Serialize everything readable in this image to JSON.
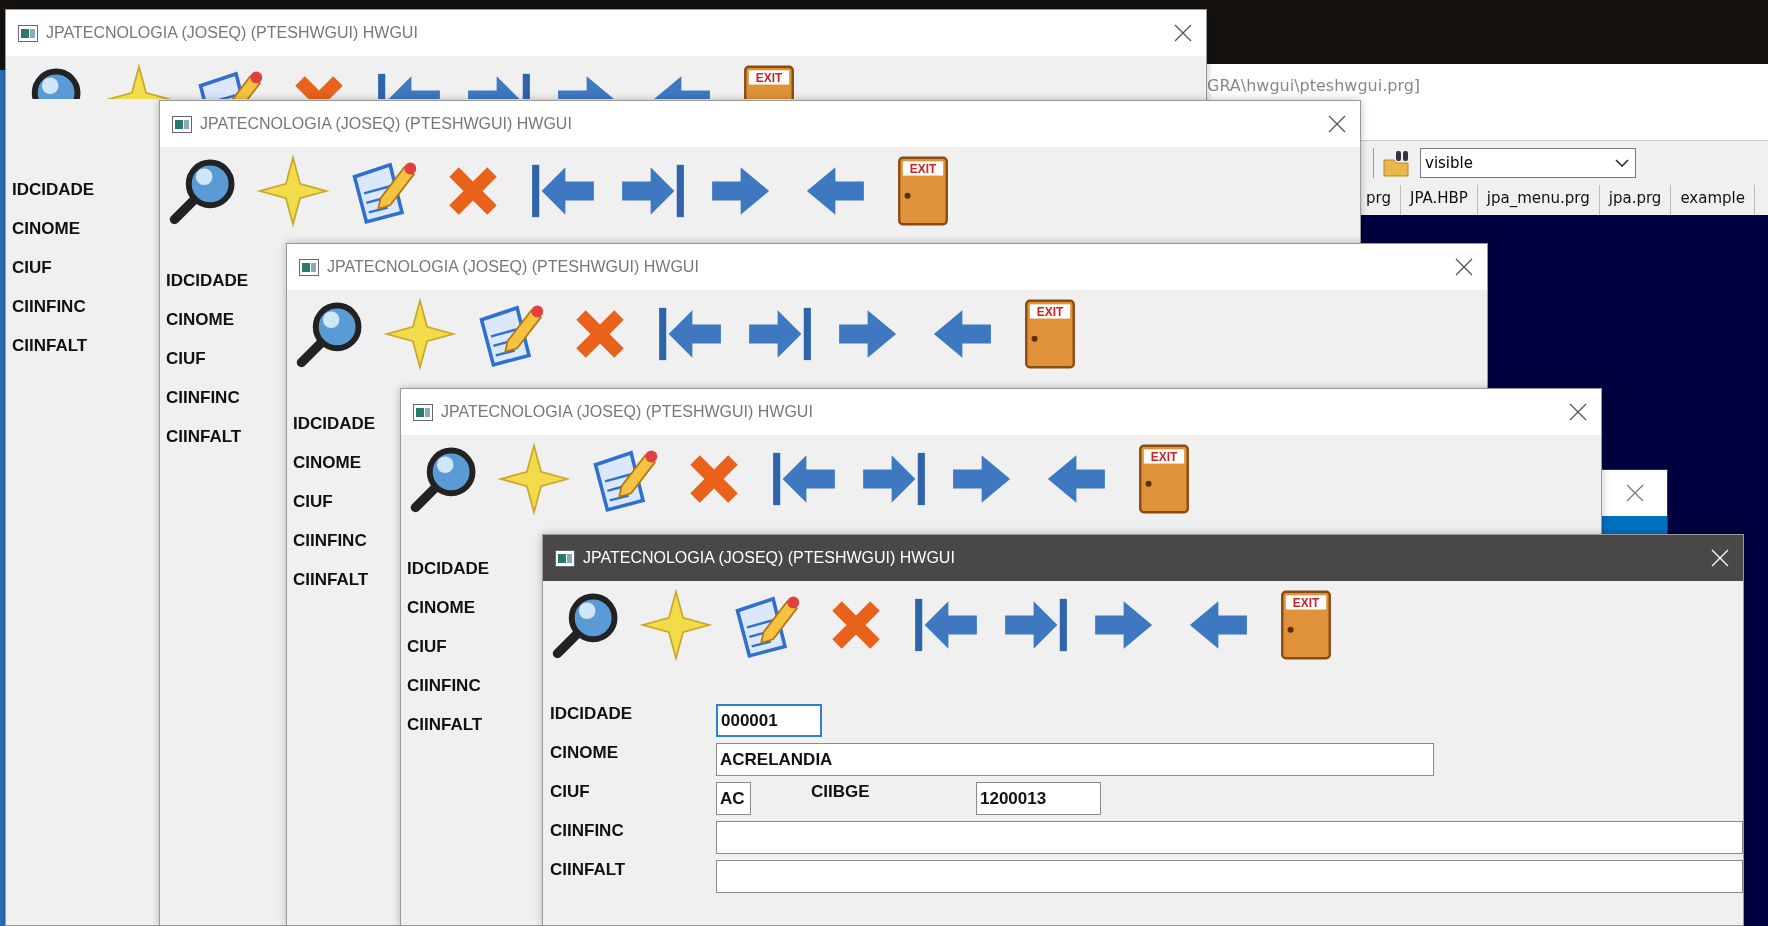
{
  "editor_window": {
    "path_text": "GRA\\hwgui\\pteshwgui.prg]",
    "search_combo": {
      "value": "visible"
    },
    "tabs": [
      {
        "label": "prg",
        "selected": false
      },
      {
        "label": "JPA.HBP",
        "selected": false
      },
      {
        "label": "jpa_menu.prg",
        "selected": false
      },
      {
        "label": "jpa.prg",
        "selected": false
      },
      {
        "label": "example",
        "selected": false
      }
    ]
  },
  "windows": [
    {
      "title": "JPATECNOLOGIA (JOSEQ) (PTESHWGUI) HWGUI",
      "active": false,
      "exit_sign": "EXIT",
      "labels": [
        "IDCIDADE",
        "CINOME",
        "CIUF",
        "CIINFINC",
        "CIINFALT"
      ]
    },
    {
      "title": "JPATECNOLOGIA (JOSEQ) (PTESHWGUI) HWGUI",
      "active": false,
      "exit_sign": "EXIT",
      "labels": [
        "IDCIDADE",
        "CINOME",
        "CIUF",
        "CIINFINC",
        "CIINFALT"
      ]
    },
    {
      "title": "JPATECNOLOGIA (JOSEQ) (PTESHWGUI) HWGUI",
      "active": false,
      "exit_sign": "EXIT",
      "labels": [
        "IDCIDADE",
        "CINOME",
        "CIUF",
        "CIINFINC",
        "CIINFALT"
      ]
    },
    {
      "title": "JPATECNOLOGIA (JOSEQ) (PTESHWGUI) HWGUI",
      "active": false,
      "exit_sign": "EXIT",
      "labels": [
        "IDCIDADE",
        "CINOME",
        "CIUF",
        "CIINFINC",
        "CIINFALT"
      ]
    },
    {
      "title": "JPATECNOLOGIA (JOSEQ) (PTESHWGUI) HWGUI",
      "active": true,
      "exit_sign": "EXIT",
      "form": [
        {
          "label": "IDCIDADE",
          "field": {
            "kind": "code",
            "value": "000001",
            "focused": true
          }
        },
        {
          "label": "CINOME",
          "field": {
            "kind": "name",
            "value": "ACRELANDIA",
            "focused": false
          }
        },
        {
          "label": "CIUF",
          "field": {
            "kind": "uf",
            "value": "AC",
            "focused": false
          },
          "extra": {
            "label": "CIIBGE",
            "field": {
              "kind": "number",
              "value": "1200013",
              "focused": false
            }
          }
        },
        {
          "label": "CIINFINC",
          "field": {
            "kind": "wide",
            "focused": false
          }
        },
        {
          "label": "CIINFALT",
          "field": {
            "kind": "wide",
            "focused": false
          }
        }
      ]
    }
  ]
}
